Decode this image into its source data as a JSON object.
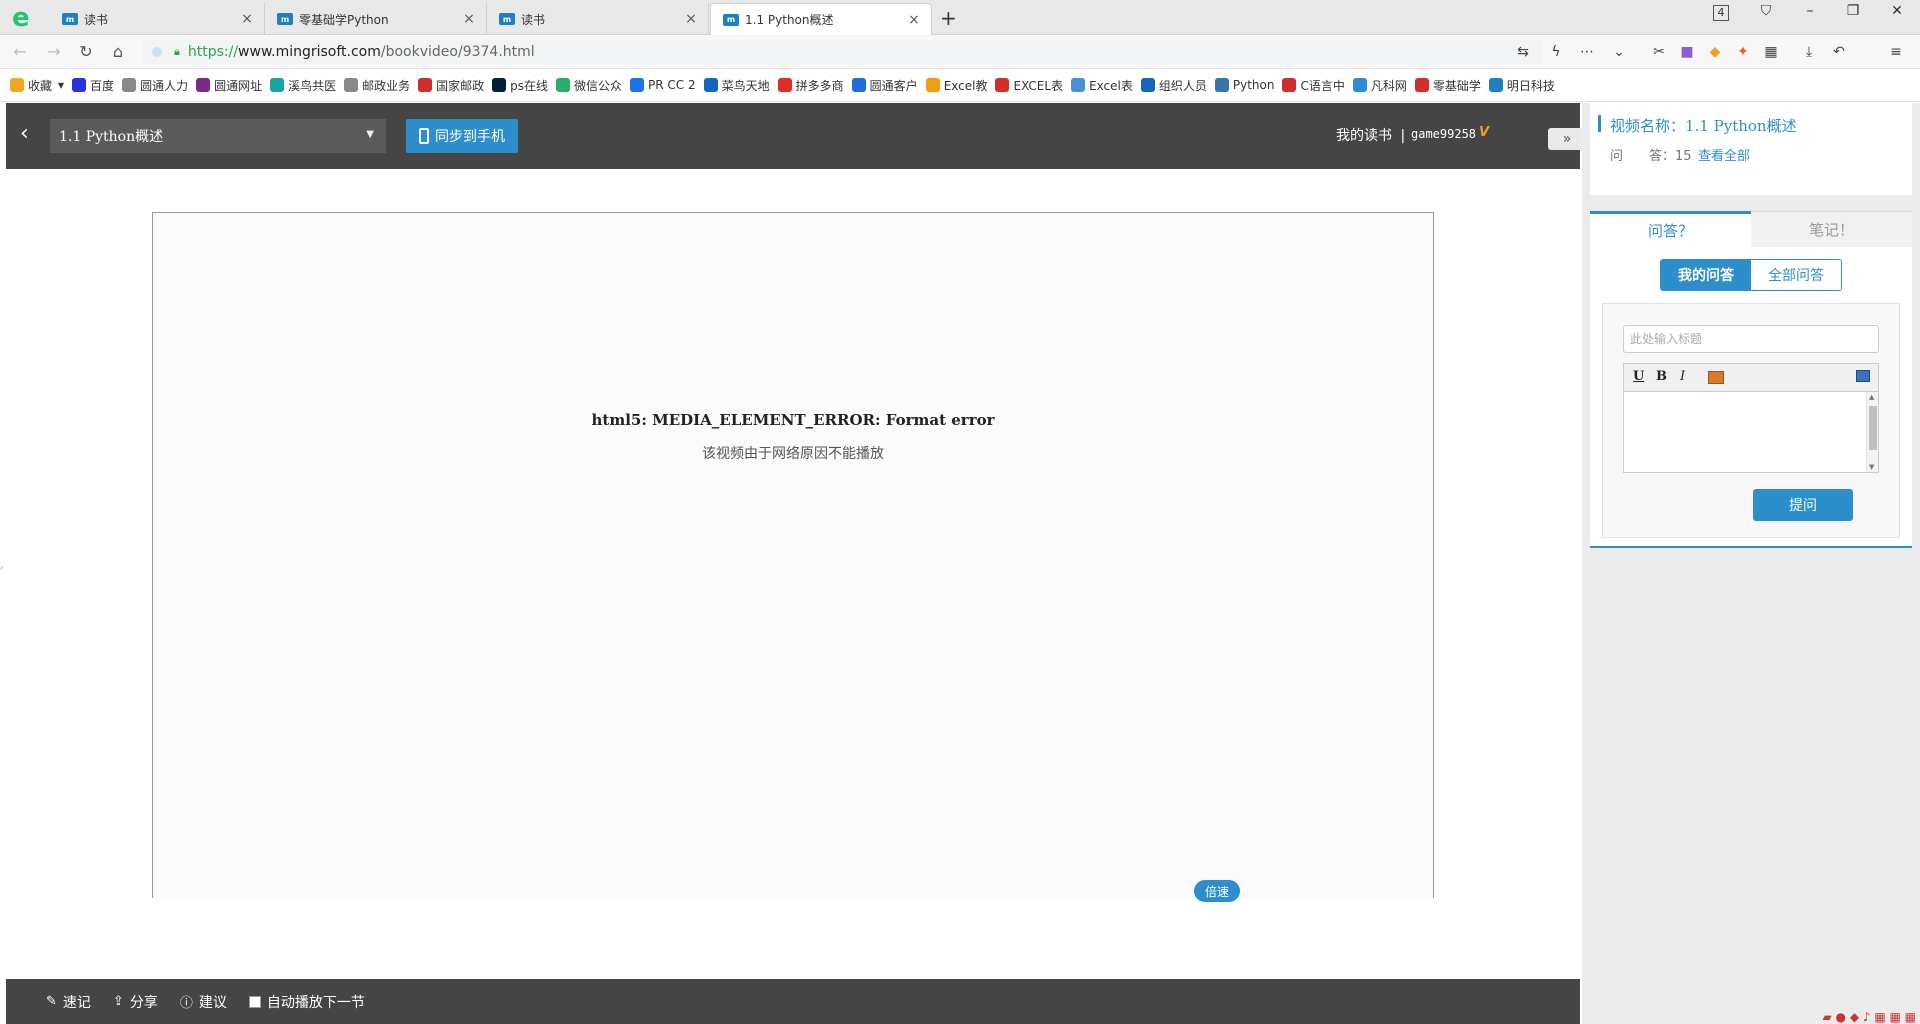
{
  "browser": {
    "tabs": [
      {
        "title": "读书",
        "icon": "mr-favicon"
      },
      {
        "title": "零基础学Python",
        "icon": "mr-favicon"
      },
      {
        "title": "读书",
        "icon": "mr-favicon"
      },
      {
        "title": "1.1 Python概述",
        "icon": "mr-favicon",
        "active": true
      }
    ],
    "tab_count_badge": "4",
    "url": {
      "scheme": "https://",
      "host": "www.mingrisoft.com",
      "path": "/bookvideo/9374.html"
    },
    "bookmarks": [
      {
        "label": "收藏",
        "color": "#f5a623"
      },
      {
        "label": "百度",
        "color": "#2932e1"
      },
      {
        "label": "圆通人力",
        "color": "#888888"
      },
      {
        "label": "圆通网址",
        "color": "#7b2a8c"
      },
      {
        "label": "溪鸟共医",
        "color": "#1aa3a3"
      },
      {
        "label": "邮政业务",
        "color": "#888888"
      },
      {
        "label": "国家邮政",
        "color": "#d0302a"
      },
      {
        "label": "ps在线",
        "color": "#001e36"
      },
      {
        "label": "微信公众",
        "color": "#2aae67"
      },
      {
        "label": "PR CC 2",
        "color": "#1a73e8"
      },
      {
        "label": "菜鸟天地",
        "color": "#1565c0"
      },
      {
        "label": "拼多多商",
        "color": "#e02e24"
      },
      {
        "label": "圆通客户",
        "color": "#1e6fd9"
      },
      {
        "label": "Excel教",
        "color": "#f39c12"
      },
      {
        "label": "EXCEL表",
        "color": "#d0302a"
      },
      {
        "label": "Excel表",
        "color": "#4a90d9"
      },
      {
        "label": "组织人员",
        "color": "#1565c0"
      },
      {
        "label": "Python",
        "color": "#3776ab"
      },
      {
        "label": "C语言中",
        "color": "#d0302a"
      },
      {
        "label": "凡科网",
        "color": "#2a8bd6"
      },
      {
        "label": "零基础学",
        "color": "#d0302a"
      },
      {
        "label": "明日科技",
        "color": "#1e7fc2"
      }
    ]
  },
  "header": {
    "chapter": "1.1 Python概述",
    "sync_label": "同步到手机",
    "my_reading": "我的读书",
    "separator": "|",
    "username": "game99258",
    "vip_badge": "V",
    "collapse_glyph": "»"
  },
  "player": {
    "error_title": "html5: MEDIA_ELEMENT_ERROR: Format error",
    "error_message": "该视频由于网络原因不能播放",
    "speed_label": "倍速"
  },
  "bottombar": {
    "note": "速记",
    "share": "分享",
    "suggest": "建议",
    "autoplay": "自动播放下一节"
  },
  "sidebar": {
    "video_title": "视频名称：1.1 Python概述",
    "qa_prefix": "问　　答：15",
    "view_all": "查看全部",
    "tab_qa": "问答？",
    "tab_notes": "笔记！",
    "my_questions": "我的问答",
    "all_questions": "全部问答",
    "title_placeholder": "此处输入标题",
    "ask_button": "提问"
  },
  "colors": {
    "accent": "#2c8fcb",
    "topbar": "#454545"
  }
}
